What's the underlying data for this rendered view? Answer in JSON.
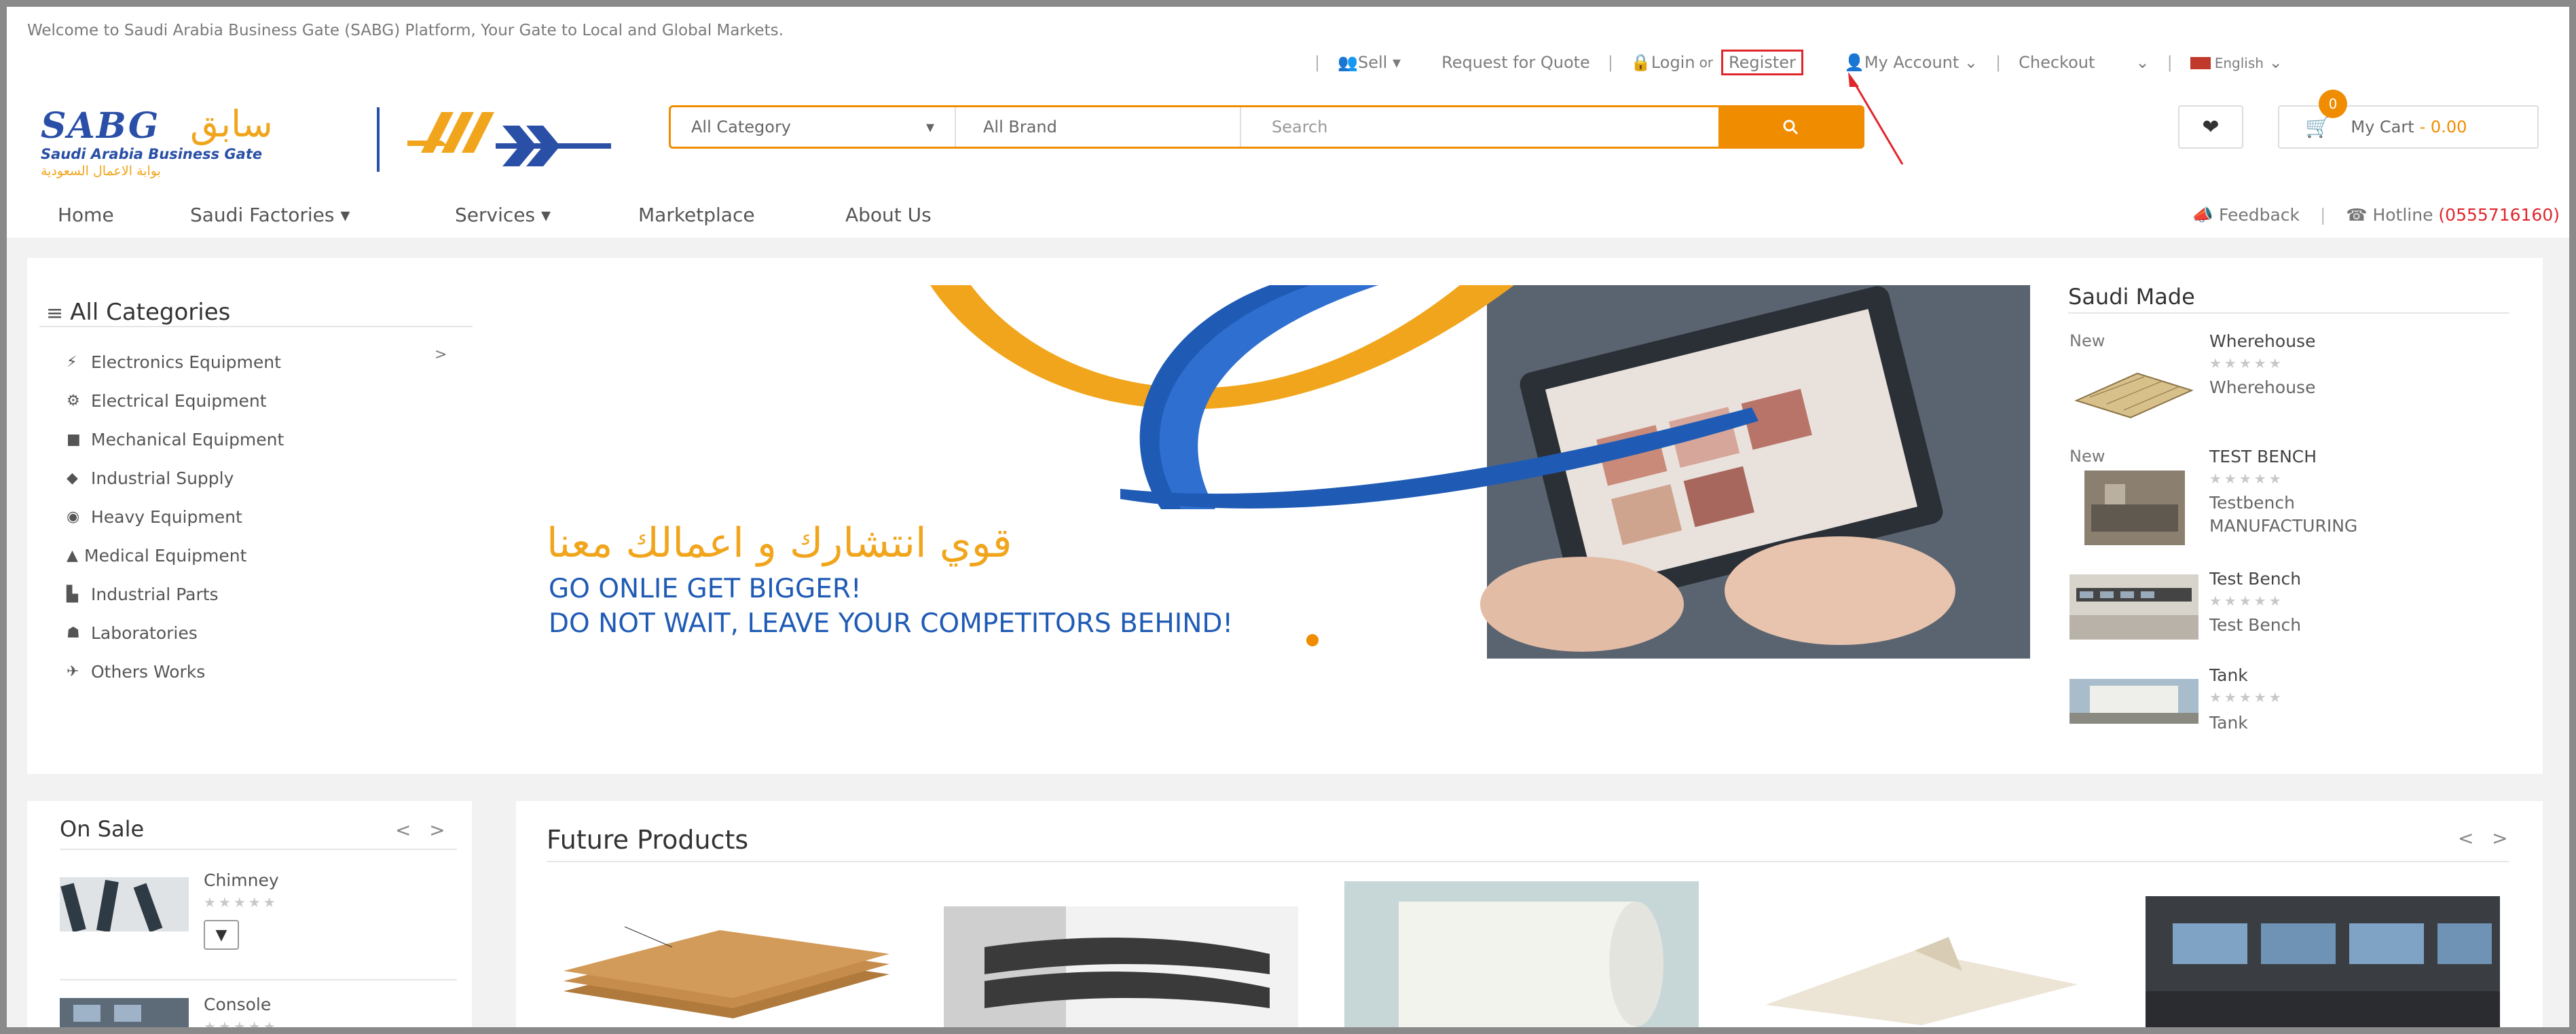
{
  "topbar": {
    "welcome": "Welcome to Saudi Arabia Business Gate (SABG) Platform, Your Gate to Local and Global Markets.",
    "sell": "Sell",
    "request_quote": "Request for Quote",
    "login": "Login",
    "or": "or",
    "register": "Register",
    "my_account": "My Account",
    "checkout": "Checkout",
    "language": "English"
  },
  "logo": {
    "name_en": "SABG",
    "name_ar": "سابق",
    "tagline_en": "Saudi Arabia Business Gate",
    "tagline_ar": "بوابة الاعمال السعودية"
  },
  "search": {
    "category": "All Category",
    "brand": "All Brand",
    "placeholder": "Search"
  },
  "cart": {
    "label": "My Cart",
    "total": "- 0.00",
    "count": "0"
  },
  "nav": {
    "home": "Home",
    "saudi_factories": "Saudi Factories",
    "services": "Services",
    "marketplace": "Marketplace",
    "about": "About Us",
    "feedback": "Feedback",
    "hotline_label": "Hotline",
    "hotline_number": "(0555716160)"
  },
  "categories": {
    "title": "All Categories",
    "items": [
      {
        "label": "Electronics Equipment",
        "icon": "plug-icon"
      },
      {
        "label": "Electrical Equipment",
        "icon": "cable-icon"
      },
      {
        "label": "Mechanical Equipment",
        "icon": "video-icon"
      },
      {
        "label": "Industrial Supply",
        "icon": "diamond-icon"
      },
      {
        "label": "Heavy Equipment",
        "icon": "gear-icon"
      },
      {
        "label": "Medical Equipment",
        "icon": "flask-icon"
      },
      {
        "label": "Industrial Parts",
        "icon": "factory-icon"
      },
      {
        "label": "Laboratories",
        "icon": "microscope-icon"
      },
      {
        "label": "Others Works",
        "icon": "tools-icon"
      }
    ]
  },
  "banner": {
    "arabic_text": "قوي انتشارك و اعمالك معنا",
    "line1": "GO ONLIE GET BIGGER!",
    "line2": "DO NOT WAIT, LEAVE YOUR COMPETITORS BEHIND!"
  },
  "saudi_made": {
    "title": "Saudi Made",
    "items": [
      {
        "badge": "New",
        "name": "Wherehouse",
        "stars": "★★★★★",
        "sub": "Wherehouse",
        "sub2": ""
      },
      {
        "badge": "New",
        "name": "TEST BENCH",
        "stars": "★★★★★",
        "sub": "Testbench",
        "sub2": "MANUFACTURING"
      },
      {
        "badge": "",
        "name": "Test Bench",
        "stars": "★★★★★",
        "sub": "Test Bench",
        "sub2": ""
      },
      {
        "badge": "",
        "name": "Tank",
        "stars": "★★★★★",
        "sub": "Tank",
        "sub2": ""
      }
    ]
  },
  "on_sale": {
    "title": "On Sale",
    "items": [
      {
        "name": "Chimney",
        "stars": "★★★★★"
      },
      {
        "name": "Console",
        "stars": "★★★★★"
      }
    ]
  },
  "future_products": {
    "title": "Future Products"
  },
  "colors": {
    "accent": "#f08c00",
    "brand_blue": "#2a4fa7",
    "brand_gold": "#f1a51c",
    "highlight": "#e0262c"
  }
}
